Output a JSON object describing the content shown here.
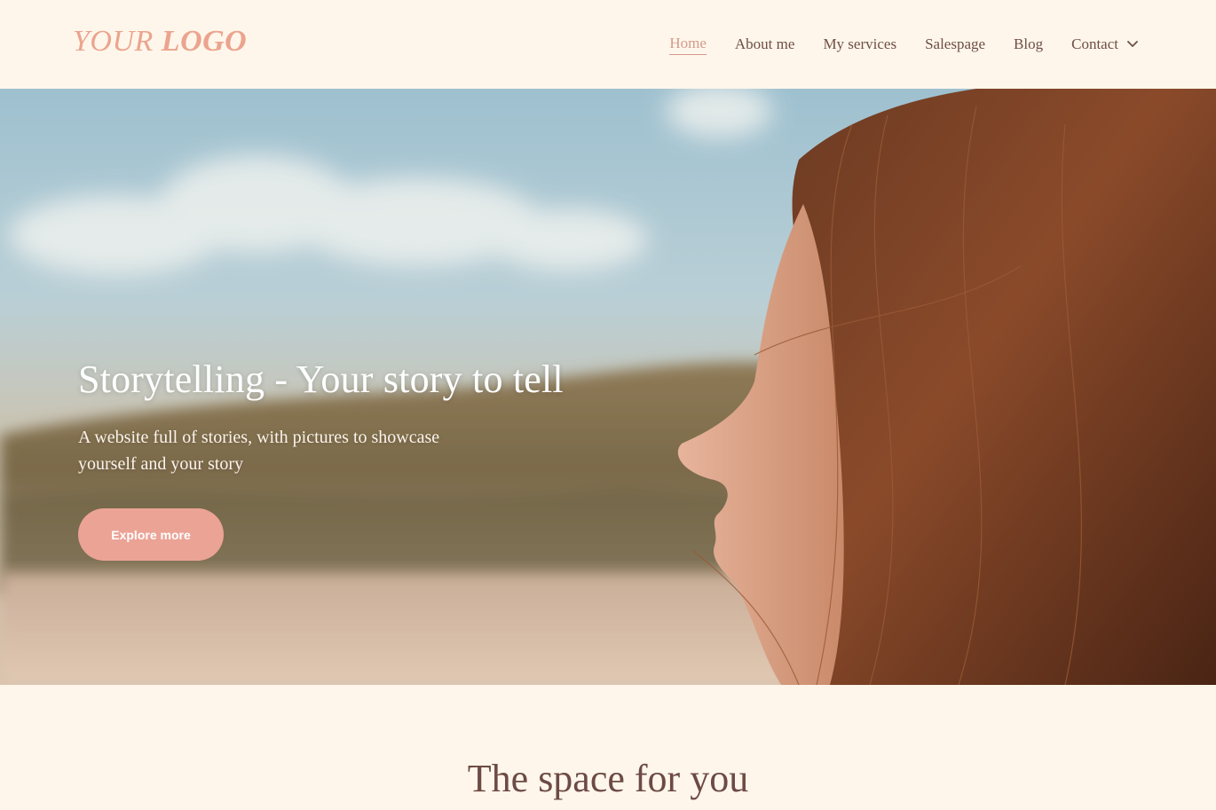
{
  "header": {
    "logo_light": "YOUR",
    "logo_bold": "LOGO",
    "nav": [
      {
        "label": "Home",
        "active": true
      },
      {
        "label": "About me"
      },
      {
        "label": "My services"
      },
      {
        "label": "Salespage"
      },
      {
        "label": "Blog"
      },
      {
        "label": "Contact"
      }
    ]
  },
  "hero": {
    "title": "Storytelling - Your story to tell",
    "subtitle": "A website full of stories, with pictures to showcase yourself and your story",
    "button_label": "Explore more",
    "image_icon": "portrait-photo"
  },
  "section": {
    "title": "The space for you"
  },
  "colors": {
    "background": "#fef6ea",
    "accent": "#eba396",
    "logo": "#eba48e",
    "nav_text": "#6f4e45",
    "nav_active": "#d49a8d",
    "heading": "#6d4a44"
  }
}
